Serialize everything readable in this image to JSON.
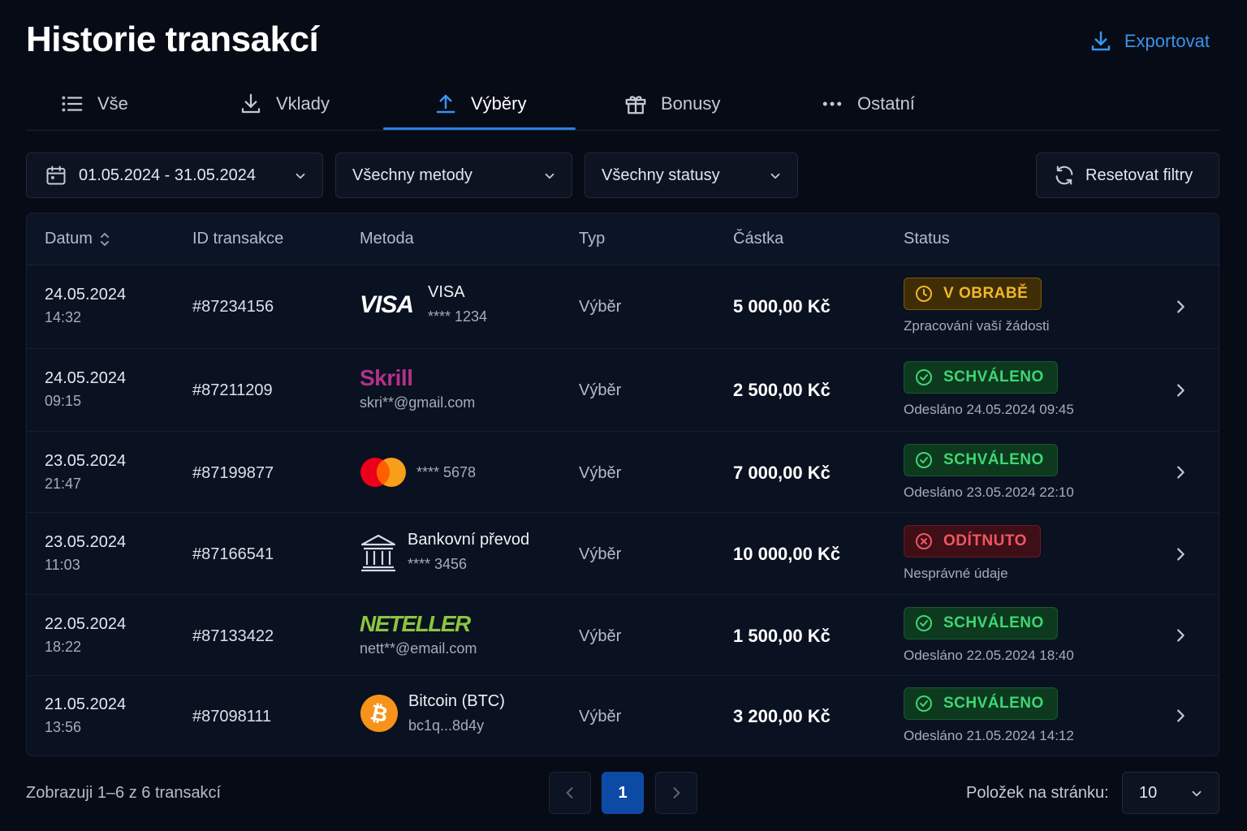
{
  "header": {
    "title": "Historie transakcí",
    "export_label": "Exportovat"
  },
  "tabs": [
    {
      "label": "Vše",
      "icon": "list-icon"
    },
    {
      "label": "Vklady",
      "icon": "download-icon"
    },
    {
      "label": "Výběry",
      "icon": "upload-icon",
      "active": true
    },
    {
      "label": "Bonusy",
      "icon": "gift-icon"
    },
    {
      "label": "Ostatní",
      "icon": "more-dots-icon"
    }
  ],
  "filters": {
    "date_range": "01.05.2024 - 31.05.2024",
    "method": "Všechny metody",
    "status": "Všechny statusy",
    "reset_label": "Resetovat filtry"
  },
  "table": {
    "columns": [
      "Datum",
      "ID transakce",
      "Metoda",
      "Typ",
      "Částka",
      "Status"
    ],
    "rows": [
      {
        "date": "24.05.2024",
        "time": "14:32",
        "id": "#87234156",
        "method_logo": "VISA",
        "method_name": "VISA",
        "method_detail": "**** 1234",
        "type": "Výběr",
        "amount": "5 000,00 Kč",
        "status": "V OBRABĚ",
        "status_kind": "pending",
        "status_note": "Zpracování vaší žádosti"
      },
      {
        "date": "24.05.2024",
        "time": "09:15",
        "id": "#87211209",
        "method_logo": "Skrill",
        "method_name": "",
        "method_detail": "skri**@gmail.com",
        "type": "Výběr",
        "amount": "2 500,00 Kč",
        "status": "SCHVÁLENO",
        "status_kind": "ok",
        "status_note": "Odesláno 24.05.2024 09:45"
      },
      {
        "date": "23.05.2024",
        "time": "21:47",
        "id": "#87199877",
        "method_logo": "",
        "method_name": "",
        "method_detail": "**** 5678",
        "type": "Výběr",
        "amount": "7 000,00 Kč",
        "status": "SCHVÁLENO",
        "status_kind": "ok",
        "status_note": "Odesláno 23.05.2024 22:10"
      },
      {
        "date": "23.05.2024",
        "time": "11:03",
        "id": "#87166541",
        "method_logo": "",
        "method_name": "Bankovní převod",
        "method_detail": "**** 3456",
        "type": "Výběr",
        "amount": "10 000,00 Kč",
        "status": "ODÍTNUTO",
        "status_kind": "bad",
        "status_note": "Nesprávné údaje"
      },
      {
        "date": "22.05.2024",
        "time": "18:22",
        "id": "#87133422",
        "method_logo": "NETELLER",
        "method_name": "",
        "method_detail": "nett**@email.com",
        "type": "Výběr",
        "amount": "1 500,00 Kč",
        "status": "SCHVÁLENO",
        "status_kind": "ok",
        "status_note": "Odesláno 22.05.2024 18:40"
      },
      {
        "date": "21.05.2024",
        "time": "13:56",
        "id": "#87098111",
        "method_logo": "",
        "method_name": "Bitcoin (BTC)",
        "method_detail": "bc1q...8d4y",
        "type": "Výběr",
        "amount": "3 200,00 Kč",
        "status": "SCHVÁLENO",
        "status_kind": "ok",
        "status_note": "Odesláno 21.05.2024 14:12"
      }
    ]
  },
  "footer": {
    "summary": "Zobrazuji 1–6 z 6 transakcí",
    "current_page": "1",
    "per_page_label": "Položek na stránku:",
    "per_page_value": "10"
  },
  "colors": {
    "background": "#070b15",
    "accent": "#2d7fe0",
    "pending": "#f2b62a",
    "success": "#3fd675",
    "danger": "#f05663"
  }
}
